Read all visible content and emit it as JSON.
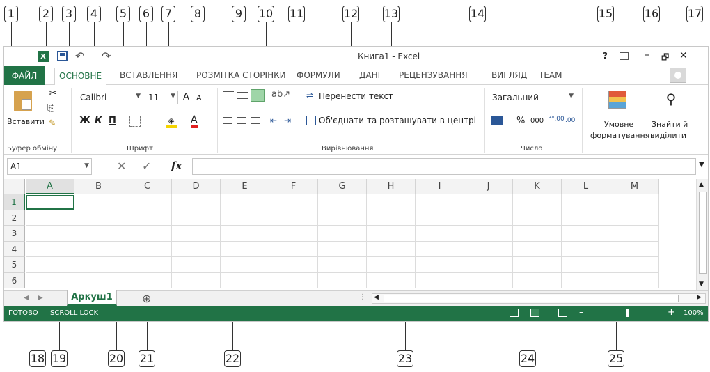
{
  "callouts": [
    "1",
    "2",
    "3",
    "4",
    "5",
    "6",
    "7",
    "8",
    "9",
    "10",
    "11",
    "12",
    "13",
    "14",
    "15",
    "16",
    "17",
    "18",
    "19",
    "20",
    "21",
    "22",
    "23",
    "24",
    "25"
  ],
  "title_bar": {
    "title": "Книга1 - Excel",
    "help": "?",
    "minimize": "–",
    "restore": "🗗",
    "close": "✕",
    "undo": "↶",
    "redo": "↷"
  },
  "tabs": {
    "file": "ФАЙЛ",
    "home": "ОСНОВНЕ",
    "insert": "ВСТАВЛЕННЯ",
    "page_layout": "РОЗМІТКА СТОРІНКИ",
    "formulas": "ФОРМУЛИ",
    "data": "ДАНІ",
    "review": "РЕЦЕНЗУВАННЯ",
    "view": "ВИГЛЯД",
    "team": "TEAM"
  },
  "ribbon": {
    "clipboard": {
      "paste": "Вставити",
      "group_label": "Буфер обміну"
    },
    "font": {
      "font_name": "Calibri",
      "font_size": "11",
      "grow": "A",
      "shrink": "A",
      "bold": "Ж",
      "italic": "К",
      "underline": "П",
      "font_color": "A",
      "group_label": "Шрифт"
    },
    "alignment": {
      "wrap_text": "Перенести текст",
      "merge_center": "Об'єднати та розташувати в центрі",
      "group_label": "Вирівнювання"
    },
    "number": {
      "format": "Загальний",
      "percent": "%",
      "thousands": "000",
      "inc_decimal": "⁺⁰.00",
      "dec_decimal": ".00",
      "group_label": "Число"
    },
    "styles": {
      "conditional_1": "Умовне",
      "conditional_2": "форматування"
    },
    "editing": {
      "find_1": "Знайти й",
      "find_2": "виділити"
    }
  },
  "formula_bar": {
    "name_box": "A1",
    "fx": "fx",
    "cancel": "✕",
    "enter": "✓",
    "content": ""
  },
  "grid": {
    "columns": [
      "A",
      "B",
      "C",
      "D",
      "E",
      "F",
      "G",
      "H",
      "I",
      "J",
      "K",
      "L",
      "M"
    ],
    "rows": [
      "1",
      "2",
      "3",
      "4",
      "5",
      "6"
    ]
  },
  "sheets": {
    "active": "Аркуш1",
    "add": "⊕"
  },
  "status": {
    "ready": "ГОТОВО",
    "scroll_lock": "SCROLL LOCK",
    "zoom": "100%",
    "zoom_fraction": 0.5
  }
}
